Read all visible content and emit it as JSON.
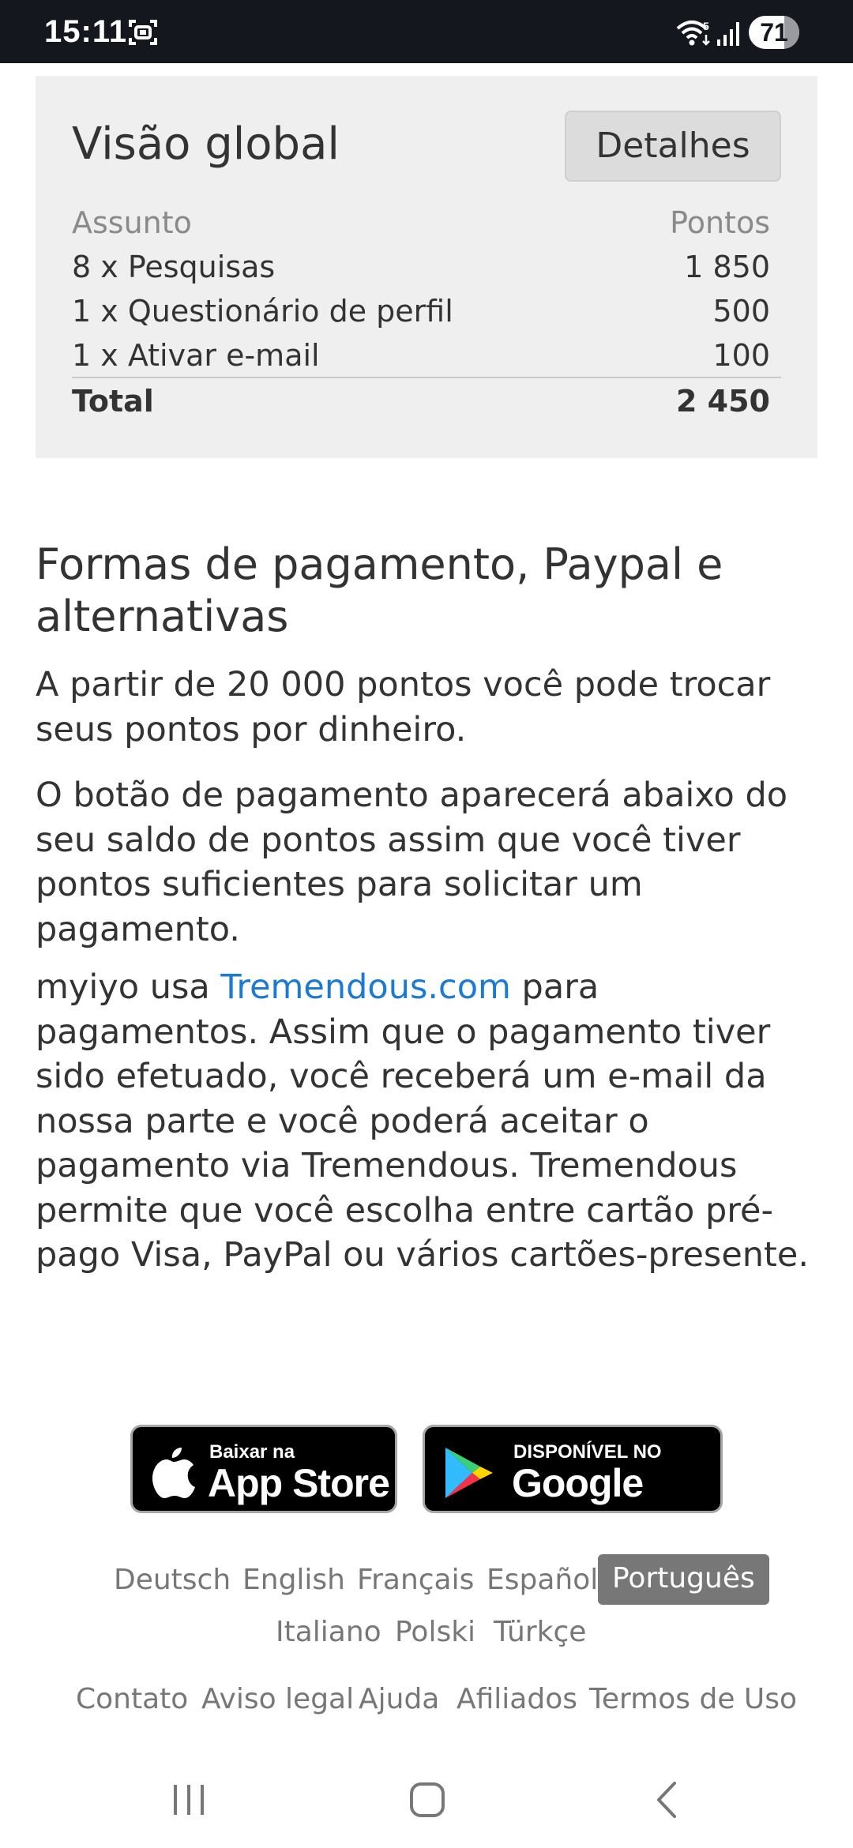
{
  "status_bar": {
    "time": "15:11",
    "battery_level": "71",
    "wifi_label": "5"
  },
  "overview": {
    "title": "Visão global",
    "details_button": "Detalhes",
    "header": {
      "subject": "Assunto",
      "points": "Pontos"
    },
    "rows": [
      {
        "subject": "8 x Pesquisas",
        "points": "1 850"
      },
      {
        "subject": "1 x Questionário de perfil",
        "points": "500"
      },
      {
        "subject": "1 x Ativar e-mail",
        "points": "100"
      }
    ],
    "total": {
      "subject": "Total",
      "points": "2 450"
    }
  },
  "payment": {
    "heading": "Formas de pagamento, Paypal e alternativas",
    "para1": "A partir de 20 000 pontos você pode trocar seus pontos por dinheiro.",
    "para2": "O botão de pagamento aparecerá abaixo do seu saldo de pontos assim que você tiver pontos suficientes para solicitar um pagamento.",
    "para3_prefix": "myiyo usa ",
    "para3_link": "Tremendous.com",
    "para3_suffix": " para pagamentos. Assim que o pagamento tiver sido efetuado, você receberá um e-mail da nossa parte e você poderá aceitar o pagamento via Tremendous. Tremendous permite que você escolha entre cartão pré-pago Visa, PayPal ou vários cartões-presente."
  },
  "store_badges": {
    "appstore": {
      "small": "Baixar na",
      "big": "App Store"
    },
    "googleplay": {
      "small": "DISPONÍVEL NO",
      "big": "Google Play"
    }
  },
  "languages": [
    "Deutsch",
    "English",
    "Français",
    "Español",
    "Português",
    "Italiano",
    "Polski",
    "Türkçe"
  ],
  "active_language": "Português",
  "footer_links": [
    "Contato",
    "Aviso legal",
    "Ajuda",
    "Afiliados",
    "Termos de Uso"
  ],
  "colors": {
    "status_bar": "#15171e",
    "card_bg": "#efefef",
    "link": "#1a7ad4",
    "muted": "#777777"
  }
}
